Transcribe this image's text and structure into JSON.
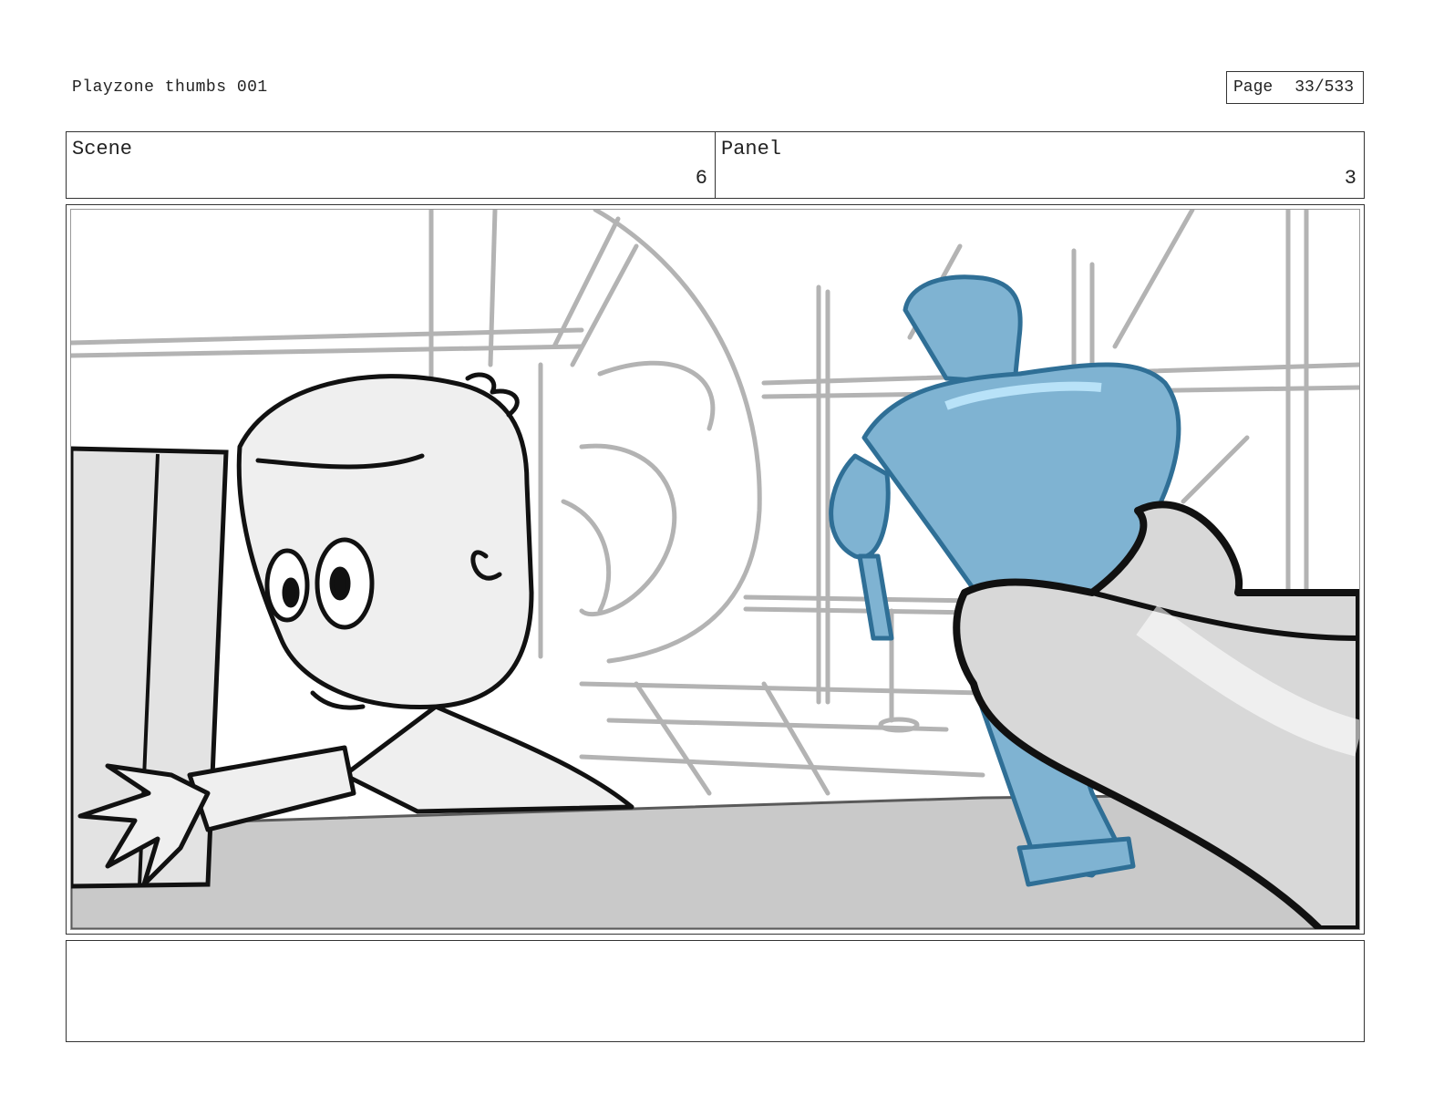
{
  "document": {
    "title": "Playzone thumbs 001",
    "page_label": "Page",
    "page_number": "33/533"
  },
  "info": {
    "scene_label": "Scene",
    "scene_value": "6",
    "panel_label": "Panel",
    "panel_value": "3"
  },
  "frame": {
    "colors": {
      "background_line": "#b3b3b3",
      "ink": "#111111",
      "table": "#c9c9c9",
      "robot": "#7fb3d2",
      "robot_highlight": "#b8e2f8",
      "robot_outline": "#2f6f96",
      "skin": "#efefef"
    }
  },
  "notes": {
    "text": ""
  }
}
